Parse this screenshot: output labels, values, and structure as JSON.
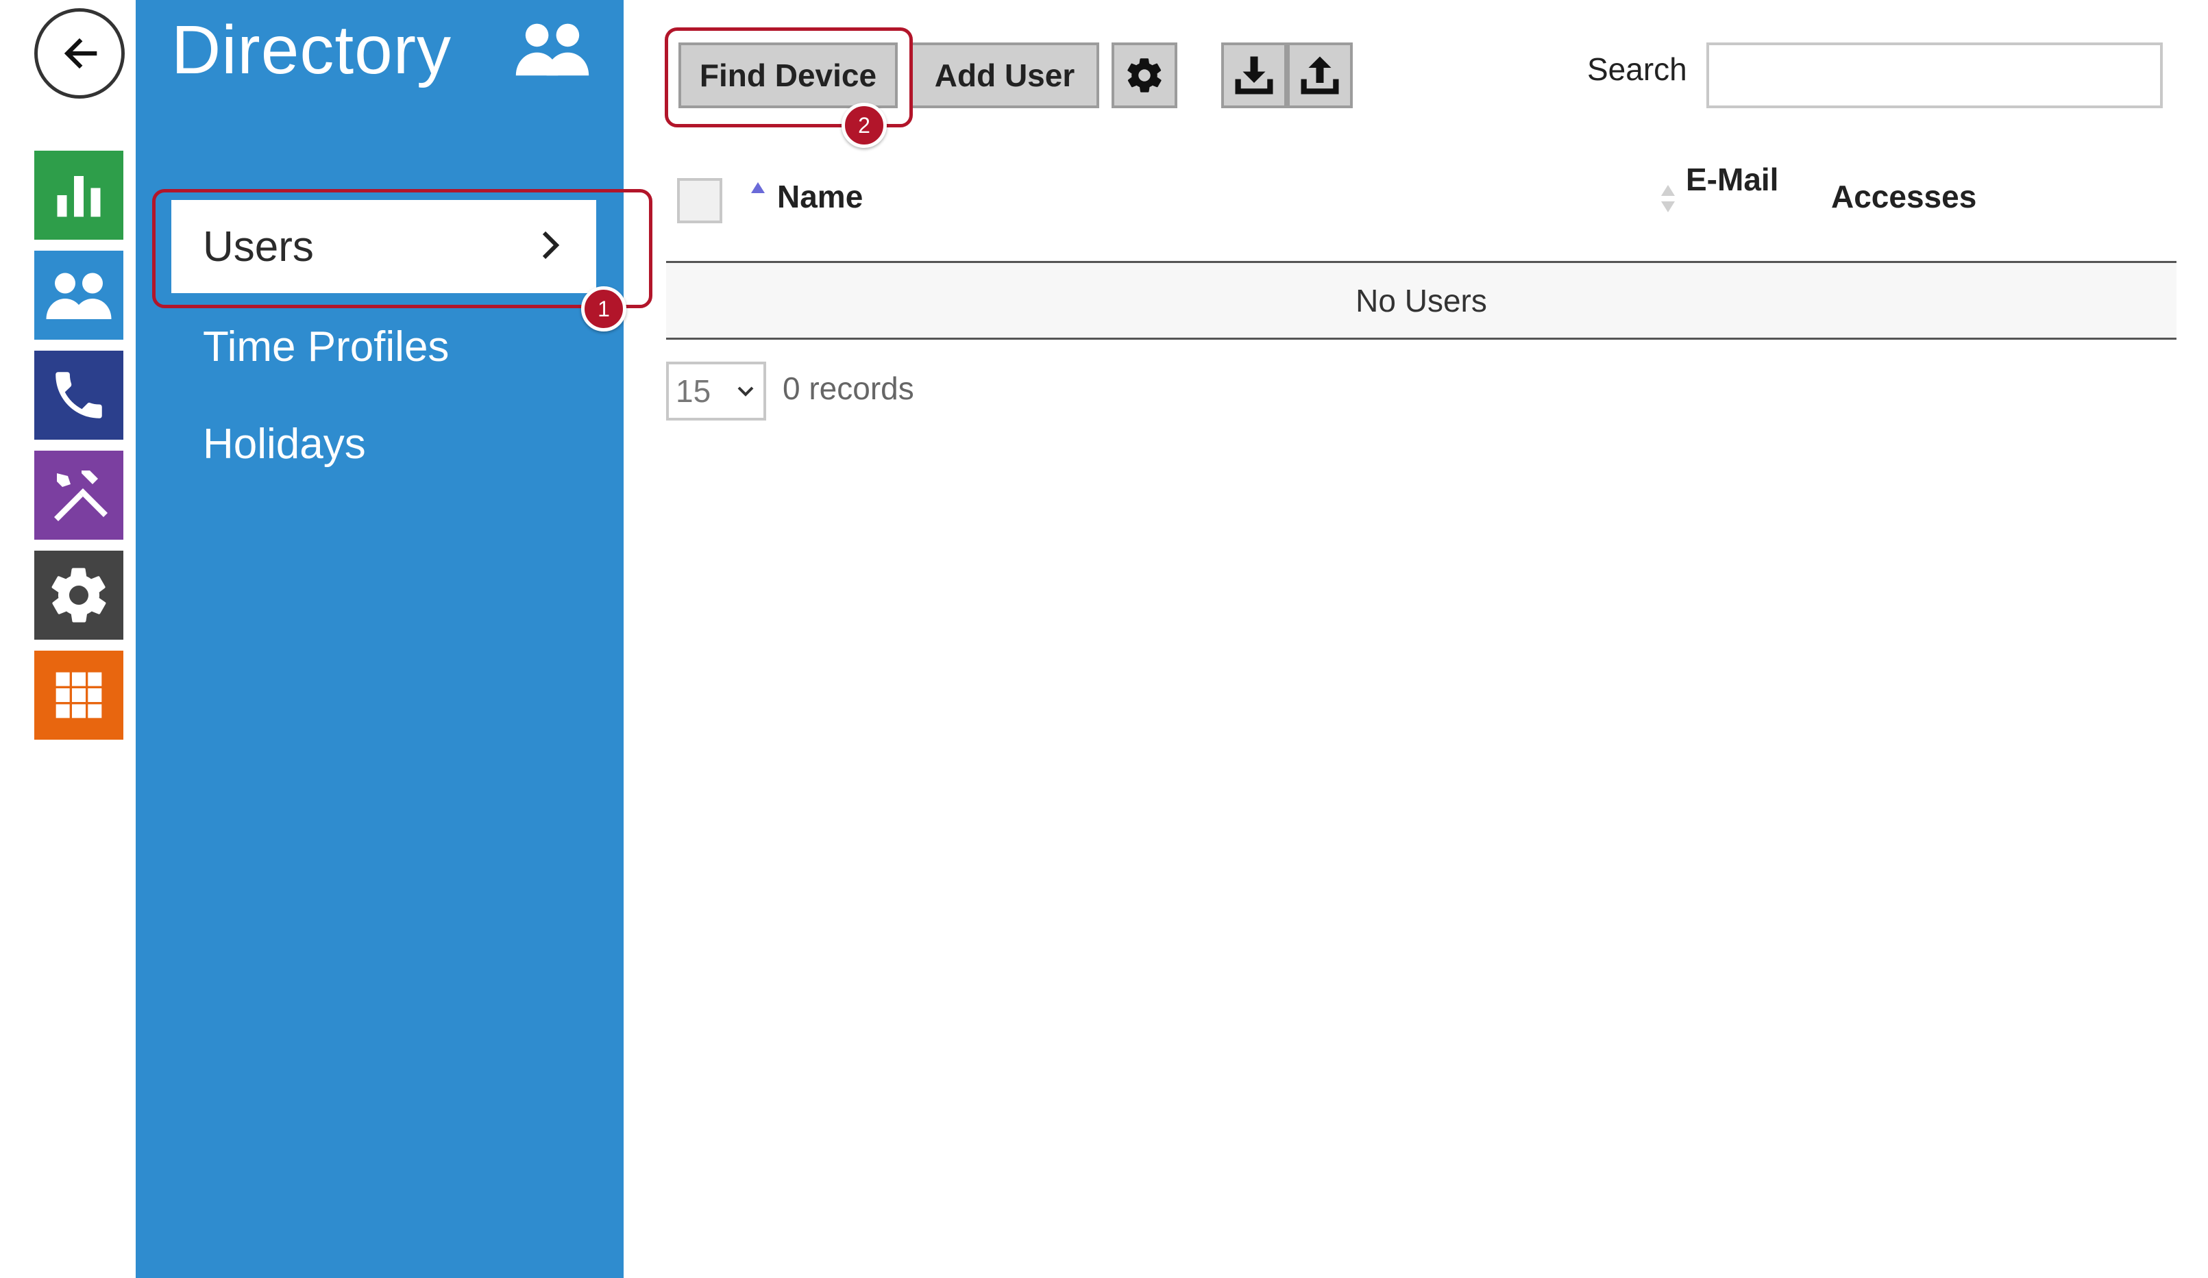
{
  "rail": {
    "back": "back-arrow-icon",
    "tiles": [
      "status-chart-icon",
      "directory-users-icon",
      "phone-icon",
      "tools-icon",
      "settings-gear-icon",
      "grid-apps-icon"
    ]
  },
  "sidebar": {
    "title": "Directory",
    "items": [
      {
        "label": "Users",
        "active": true
      },
      {
        "label": "Time Profiles"
      },
      {
        "label": "Holidays"
      }
    ]
  },
  "callouts": {
    "one": "1",
    "two": "2"
  },
  "toolbar": {
    "find_device": "Find Device",
    "add_user": "Add User"
  },
  "search": {
    "label": "Search",
    "value": "",
    "placeholder": ""
  },
  "table": {
    "columns": {
      "name": "Name",
      "email": "E-Mail",
      "accesses": "Accesses"
    },
    "empty": "No Users"
  },
  "pager": {
    "page_size": "15",
    "records": "0 records"
  },
  "colors": {
    "sidebar": "#2f8ccf",
    "callout": "#b2152a",
    "status": "#2e9e4a",
    "directory": "#2f8ccf",
    "phone": "#2b3f8c",
    "tools": "#7b3fa0",
    "settings": "#444444",
    "apps": "#e8660f"
  }
}
